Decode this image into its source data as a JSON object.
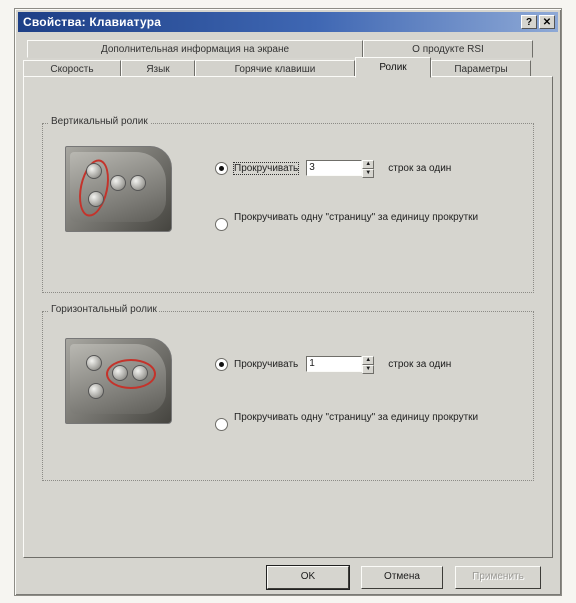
{
  "window": {
    "title": "Свойства: Клавиатура",
    "help_btn": "?",
    "close_btn": "✕"
  },
  "tabs_row1": [
    {
      "label": "Дополнительная информация на экране"
    },
    {
      "label": "О продукте RSI"
    }
  ],
  "tabs_row2": [
    {
      "label": "Скорость"
    },
    {
      "label": "Язык"
    },
    {
      "label": "Горячие клавиши"
    },
    {
      "label": "Ролик",
      "active": true
    },
    {
      "label": "Параметры"
    }
  ],
  "vertical": {
    "legend": "Вертикальный ролик",
    "opt1_label": "Прокручивать",
    "opt1_value": "3",
    "opt1_unit": "строк за один",
    "opt2_label": "Прокручивать одну \"страницу\" за единицу прокрутки",
    "selected": "opt1"
  },
  "horizontal": {
    "legend": "Горизонтальный ролик",
    "opt1_label": "Прокручивать",
    "opt1_value": "1",
    "opt1_unit": "строк за один",
    "opt2_label": "Прокручивать одну \"страницу\" за единицу прокрутки",
    "selected": "opt1"
  },
  "buttons": {
    "ok": "OK",
    "cancel": "Отмена",
    "apply": "Применить"
  },
  "icons": {
    "help": "help-icon",
    "close": "close-icon",
    "spin_up": "arrow-up-icon",
    "spin_down": "arrow-down-icon"
  },
  "colors": {
    "titlebar_start": "#1d3f86",
    "titlebar_end": "#8ea9d6",
    "dialog_bg": "#d6d5cf",
    "highlight_ring": "#c4332b"
  }
}
